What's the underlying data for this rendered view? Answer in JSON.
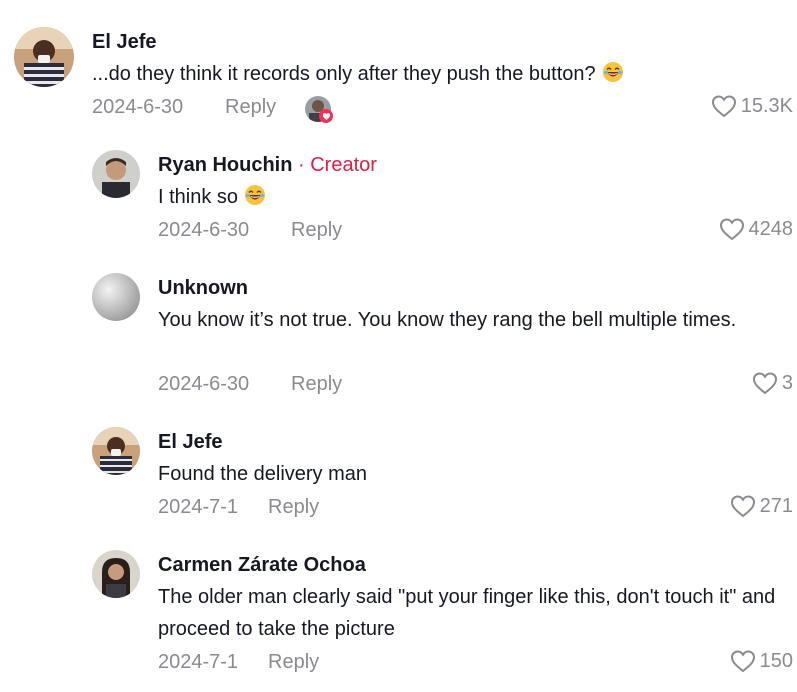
{
  "comments": [
    {
      "username": "El Jefe",
      "text": "...do they think it records only after they push the button?",
      "date": "2024-6-30",
      "reply_label": "Reply",
      "likes": "15.3K",
      "emoji": "laughing-emoji",
      "liked_by_creator": true
    },
    {
      "username": "Ryan Houchin",
      "badge": "· Creator",
      "text": "I think so",
      "date": "2024-6-30",
      "reply_label": "Reply",
      "likes": "4248",
      "emoji": "laughing-emoji"
    },
    {
      "username": "Unknown",
      "text": "You know it’s not true. You know they rang the bell multiple times.",
      "date": "2024-6-30",
      "reply_label": "Reply",
      "likes": "3"
    },
    {
      "username": "El Jefe",
      "text": "Found the delivery man",
      "date": "2024-7-1",
      "reply_label": "Reply",
      "likes": "271"
    },
    {
      "username": "Carmen Zárate Ochoa",
      "text": "The older man clearly said \"put your finger like this, don't touch it\" and proceed to take the picture",
      "date": "2024-7-1",
      "reply_label": "Reply",
      "likes": "150"
    }
  ],
  "colors": {
    "text": "#161823",
    "secondary": "#8a8b91",
    "creator": "#e11d48",
    "heart_badge": "#fe2c55"
  },
  "icons": [
    "heart-outline-icon",
    "laughing-emoji",
    "heart-badge-icon"
  ]
}
